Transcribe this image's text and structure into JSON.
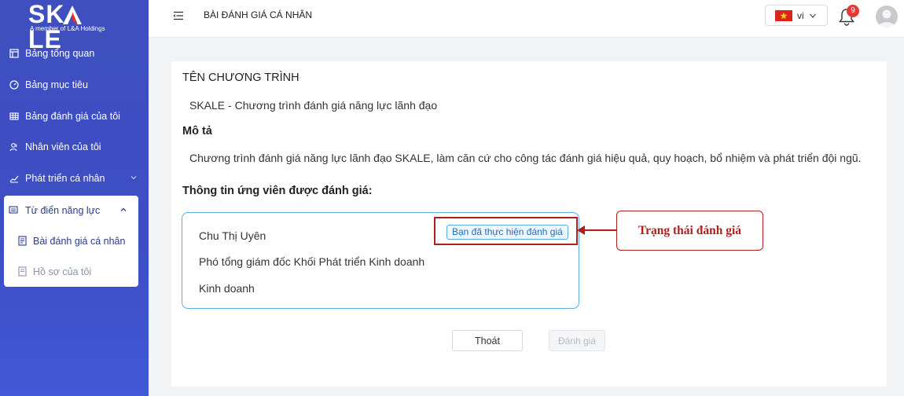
{
  "brand": {
    "name_left": "SK",
    "name_right": "LE",
    "tagline": "A member of L&A Holdings"
  },
  "sidebar": {
    "items": [
      {
        "label": "Bảng tổng quan",
        "icon": "dashboard-icon"
      },
      {
        "label": "Bảng mục tiêu",
        "icon": "gauge-icon"
      },
      {
        "label": "Bảng đánh giá của tôi",
        "icon": "grid-icon"
      },
      {
        "label": "Nhân viên của tôi",
        "icon": "users-icon"
      },
      {
        "label": "Phát triển cá nhân",
        "icon": "trend-icon"
      }
    ],
    "group": {
      "label": "Từ điển năng lực",
      "items": [
        {
          "label": "Bài đánh giá cá nhân",
          "icon": "document-icon",
          "active": true
        },
        {
          "label": "Hồ sơ của tôi",
          "icon": "profile-document-icon",
          "active": false
        }
      ]
    }
  },
  "header": {
    "title": "BÀI ĐÁNH GIÁ CÁ NHÂN",
    "language": "vi",
    "notification_count": "9"
  },
  "main": {
    "program_label": "TÊN CHƯƠNG TRÌNH",
    "program_value": "SKALE - Chương trình đánh giá năng lực lãnh đạo",
    "description_label": "Mô tả",
    "description_value": "Chương trình đánh giá năng lực lãnh đạo SKALE, làm căn cứ cho công tác đánh giá hiệu quả, quy hoạch, bổ nhiệm và phát triển đội ngũ.",
    "candidate_label": "Thông tin ứng viên được đánh giá:",
    "candidate": {
      "name": "Chu Thị Uyên",
      "position": "Phó tổng giám đốc Khối Phát triển Kinh doanh",
      "department": "Kinh doanh",
      "status": "Bạn đã thực hiện đánh giá"
    },
    "buttons": {
      "exit": "Thoát",
      "evaluate": "Đánh giá"
    }
  },
  "annotation": {
    "text": "Trạng thái đánh giá"
  },
  "colors": {
    "sidebar_bg": "#3f4fbf",
    "accent_blue": "#1f6fbf",
    "annotation_red": "#b01e1e",
    "badge_red": "#e53935"
  }
}
